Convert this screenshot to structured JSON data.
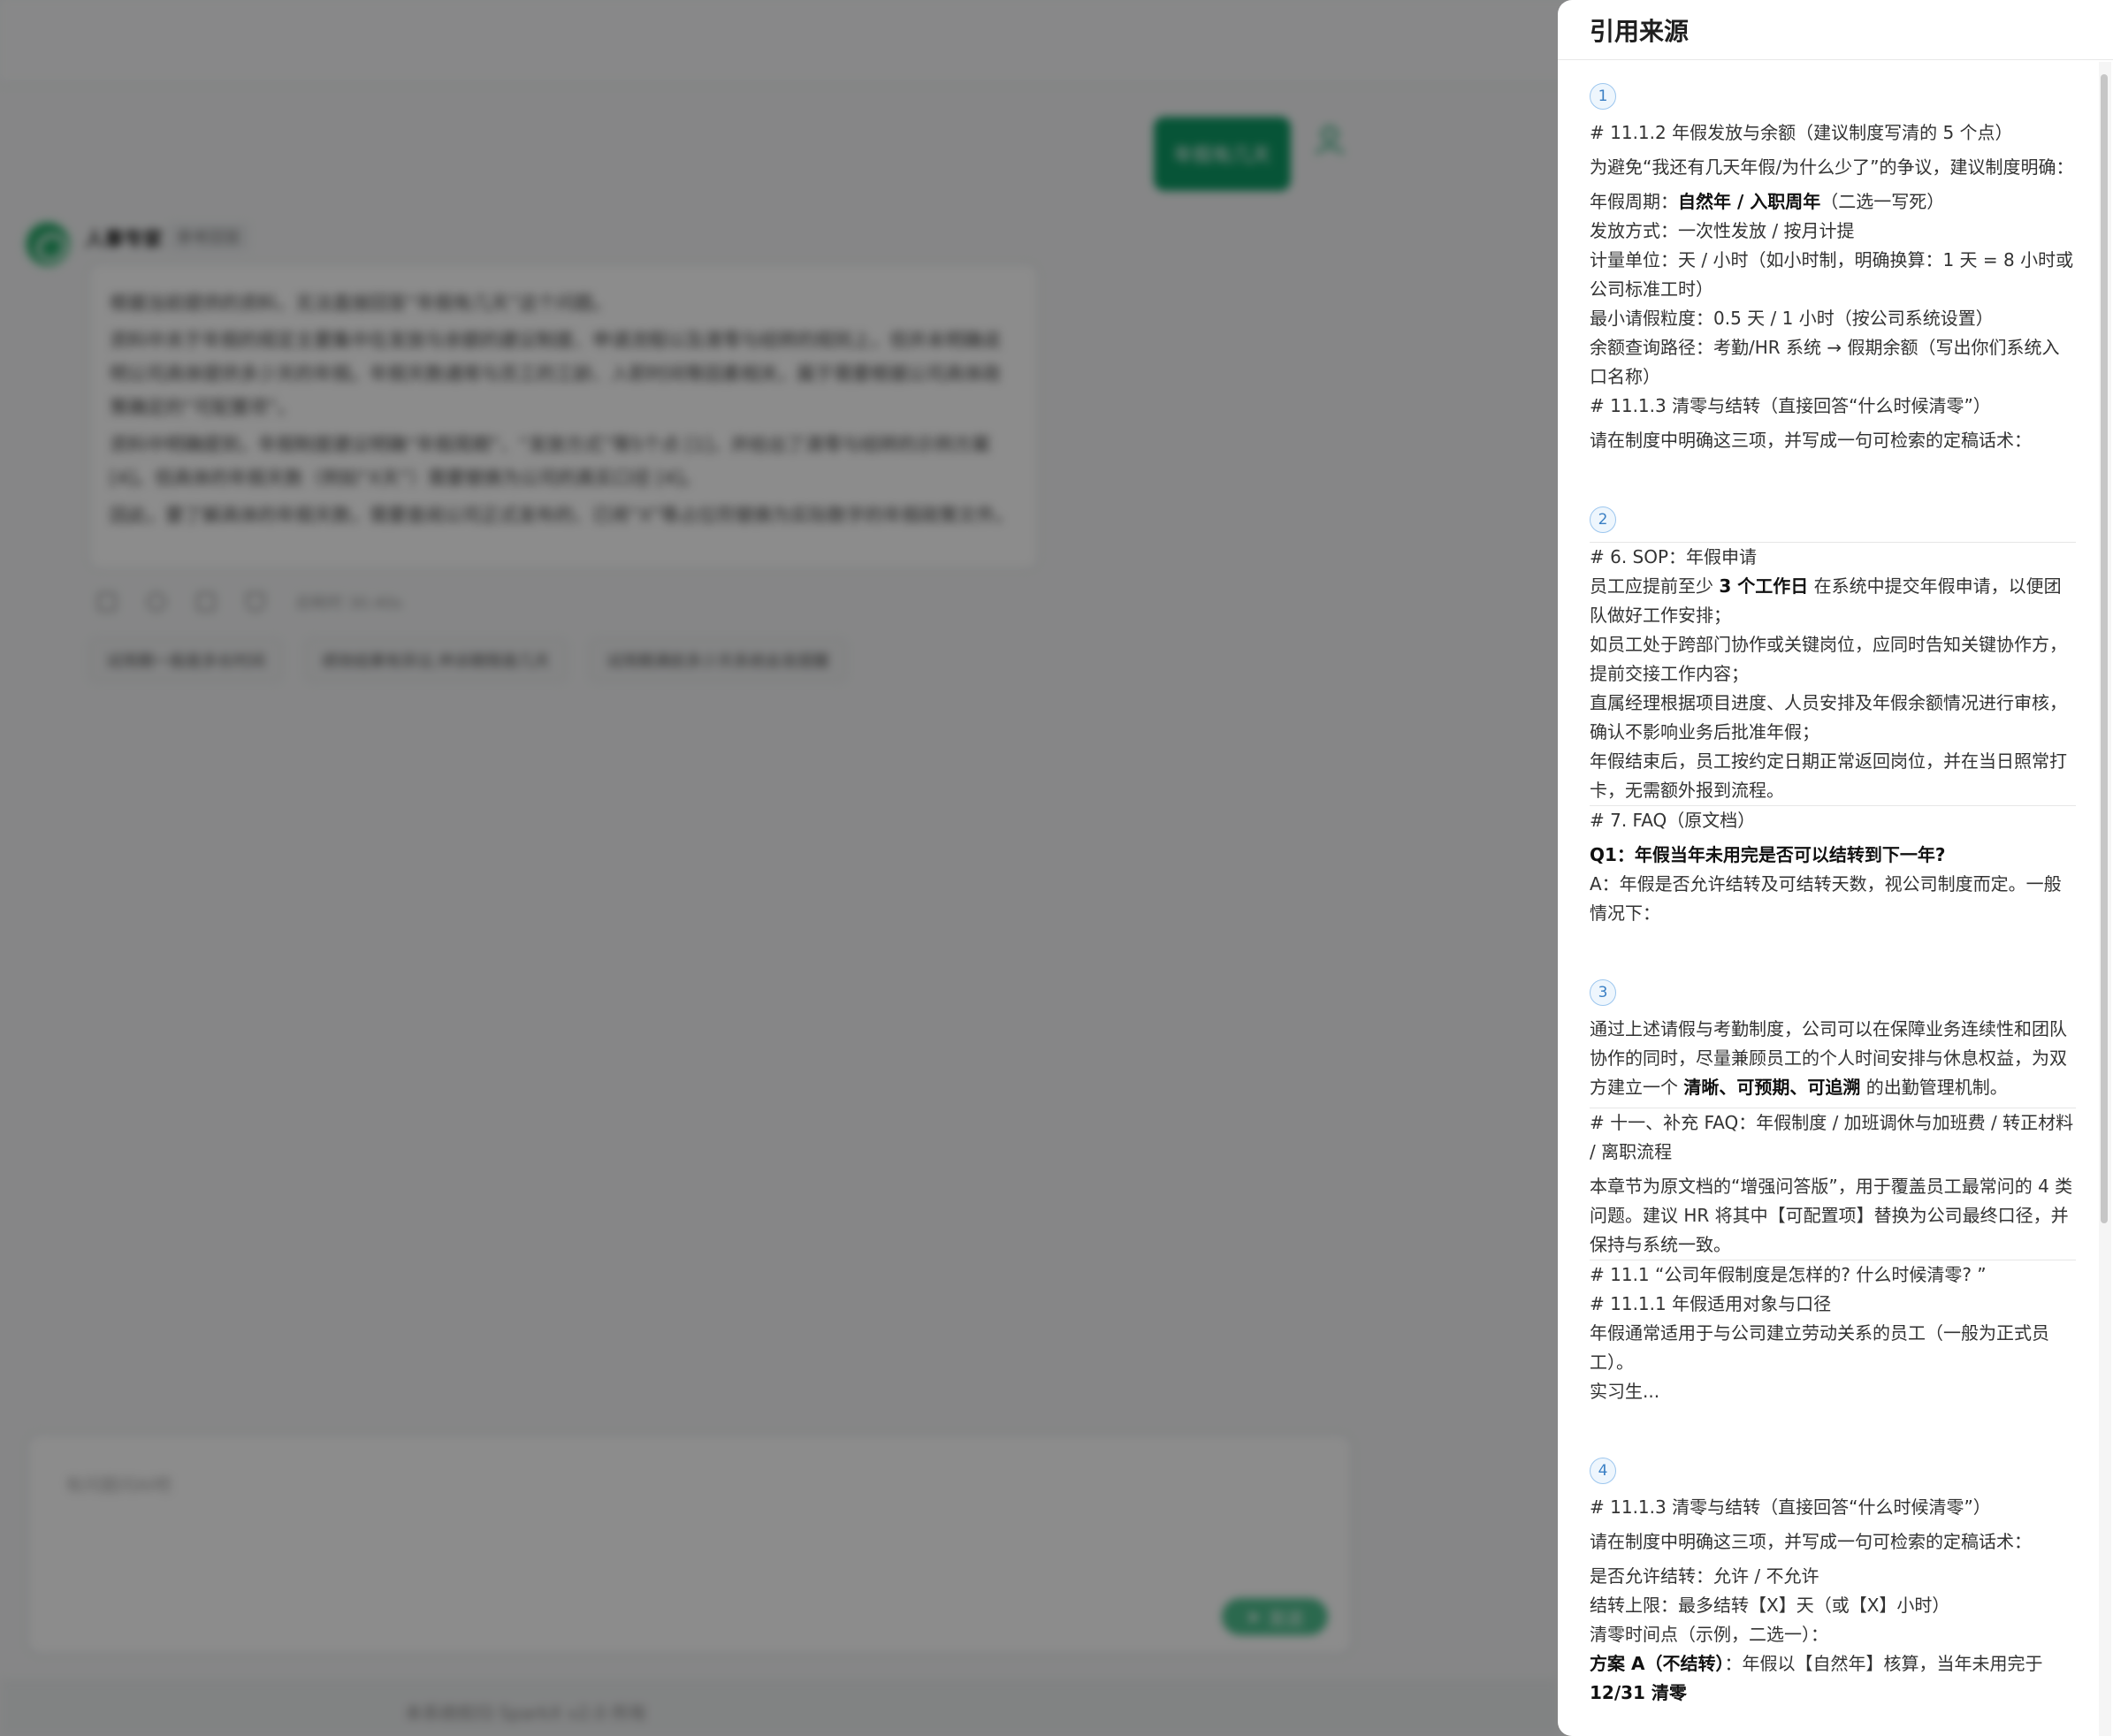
{
  "background": {
    "user_message": "年假有几天",
    "bot": {
      "name": "人事专家",
      "badge": "参考回答",
      "paragraphs": [
        "根据当前提供的资料，无法直接回答“年假有几天”这个问题。",
        "资料中关于年假的规定主要集中在发放与余额的建议制度、申请流程以及清零与结转的规则上，但并未明确说明公司具体提供多少天的年假。年假天数通常与员工的工龄、入职时间等因素相关，属于需要根据公司具体政策确定的“可配置项”。",
        "资料中明确提到，年假制度建议明确“年假周期”、“发放方式”等5个点 [1]，并给出了清零与结转的示例方案 [4]。但具体的年假天数（例如“X天”）需要替换为公司的真实口径 [4]。",
        "因此，要了解具体的年假天数，需要查阅公司正式发布的、已将“X”等占位符替换为实际数字的年假政策文件。"
      ],
      "meta": "总耗时 30.40s",
      "suggestions": [
        "试用期一般是多长时间",
        "绩效结果有异议,申诉期限是几天",
        "试用期满前多少天系统会发提醒"
      ]
    },
    "composer": {
      "placeholder": "有问题问AI吧",
      "send_label": "发送"
    },
    "footer": "本系统权归 SparkX v2.0 所有"
  },
  "drawer": {
    "title": "引用来源",
    "sources": [
      {
        "num": "1",
        "lines": [
          {
            "html": "# 11.1.2 年假发放与余额（建议制度写清的 5 个点）"
          },
          {
            "html": "为避免“我还有几天年假/为什么少了”的争议，建议制度明确：",
            "gap": true
          },
          {
            "html": "年假周期：<b>自然年 / 入职周年</b>（二选一写死）",
            "gap": true
          },
          {
            "html": "发放方式：一次性发放 / 按月计提"
          },
          {
            "html": "计量单位：天 / 小时（如小时制，明确换算：1 天 = 8 小时或公司标准工时）"
          },
          {
            "html": "最小请假粒度：0.5 天 / 1 小时（按公司系统设置）"
          },
          {
            "html": "余额查询路径：考勤/HR 系统 → 假期余额（写出你们系统入口名称）"
          },
          {
            "html": "# 11.1.3 清零与结转（直接回答“什么时候清零”）"
          },
          {
            "html": "请在制度中明确这三项，并写成一句可检索的定稿话术：",
            "gap": true
          }
        ]
      },
      {
        "num": "2",
        "lines": [
          {
            "html": "# 6. SOP：年假申请",
            "sep": true
          },
          {
            "html": "员工应提前至少 <b>3 个工作日</b> 在系统中提交年假申请，以便团队做好工作安排；"
          },
          {
            "html": "如员工处于跨部门协作或关键岗位，应同时告知关键协作方，提前交接工作内容；"
          },
          {
            "html": "直属经理根据项目进度、人员安排及年假余额情况进行审核，确认不影响业务后批准年假；"
          },
          {
            "html": "年假结束后，员工按约定日期正常返回岗位，并在当日照常打卡，无需额外报到流程。"
          },
          {
            "html": "# 7. FAQ（原文档）",
            "sep": true
          },
          {
            "html": "<b>Q1：年假当年未用完是否可以结转到下一年?</b>",
            "gap": true
          },
          {
            "html": "A：年假是否允许结转及可结转天数，视公司制度而定。一般情况下："
          }
        ]
      },
      {
        "num": "3",
        "lines": [
          {
            "html": "通过上述请假与考勤制度，公司可以在保障业务连续性和团队协作的同时，尽量兼顾员工的个人时间安排与休息权益，为双方建立一个 <b>清晰、可预期、可追溯</b> 的出勤管理机制。"
          },
          {
            "html": "# 十一、补充 FAQ：年假制度 / 加班调休与加班费 / 转正材料 / 离职流程",
            "sep": true,
            "gap": true
          },
          {
            "html": "本章节为原文档的“增强问答版”，用于覆盖员工最常问的 4 类问题。建议 HR 将其中【可配置项】替换为公司最终口径，并保持与系统一致。",
            "gap": true
          },
          {
            "html": "# 11.1 “公司年假制度是怎样的? 什么时候清零? ”",
            "sep": true
          },
          {
            "html": "# 11.1.1 年假适用对象与口径"
          },
          {
            "html": "年假通常适用于与公司建立劳动关系的员工（一般为正式员工）。"
          },
          {
            "html": "实习生..."
          }
        ]
      },
      {
        "num": "4",
        "lines": [
          {
            "html": "# 11.1.3 清零与结转（直接回答“什么时候清零”）"
          },
          {
            "html": "请在制度中明确这三项，并写成一句可检索的定稿话术：",
            "gap": true
          },
          {
            "html": "是否允许结转：允许 / 不允许",
            "gap": true
          },
          {
            "html": "结转上限：最多结转【X】天（或【X】小时）"
          },
          {
            "html": "清零时间点（示例，二选一）："
          },
          {
            "html": "<b>方案 A（不结转）</b>：年假以【自然年】核算，当年未用完于 <b>12/31 清零</b>"
          }
        ]
      }
    ]
  }
}
